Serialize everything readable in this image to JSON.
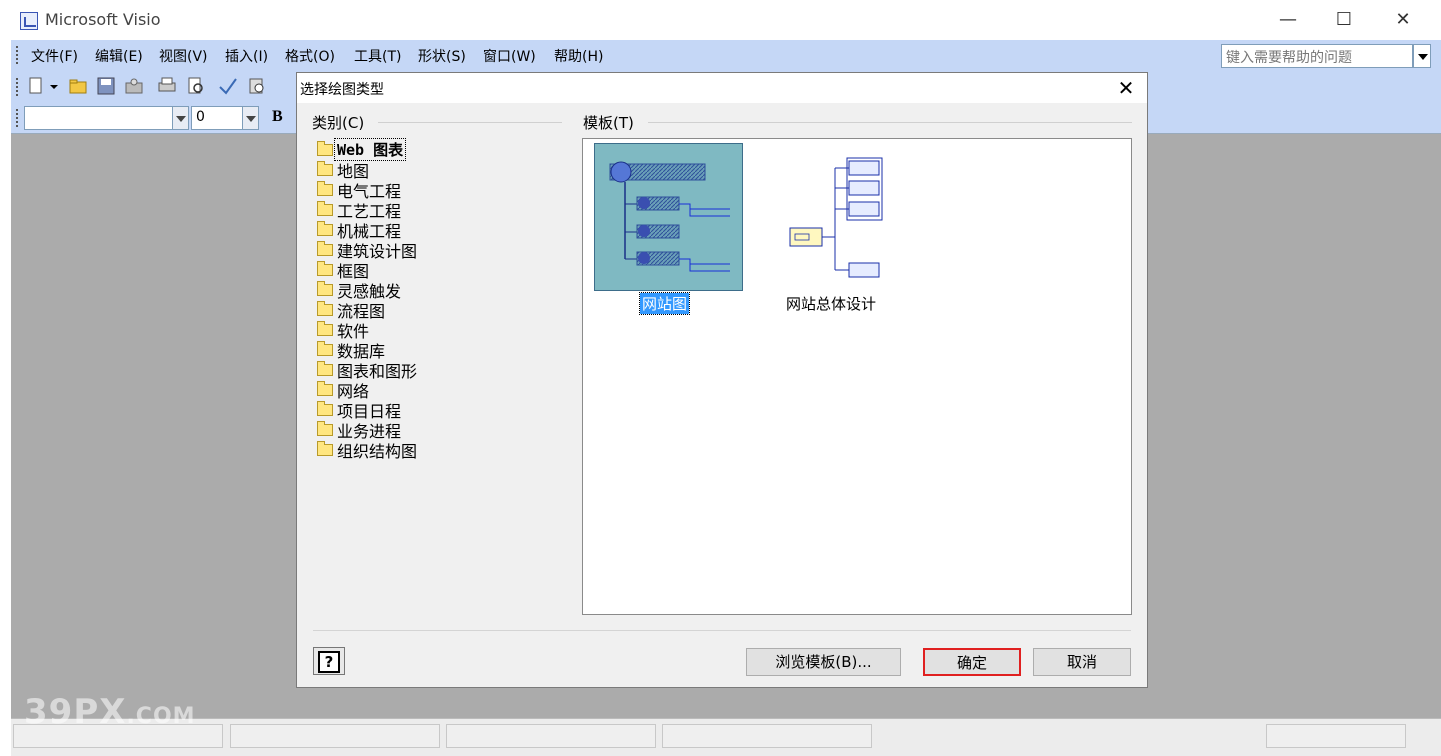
{
  "app": {
    "title": "Microsoft Visio",
    "minimize_glyph": "—",
    "maximize_glyph": "☐",
    "close_glyph": "✕"
  },
  "menu": {
    "items": [
      "文件(F)",
      "编辑(E)",
      "视图(V)",
      "插入(I)",
      "格式(O)",
      "工具(T)",
      "形状(S)",
      "窗口(W)",
      "帮助(H)"
    ],
    "help_placeholder": "键入需要帮助的问题"
  },
  "toolbar": {
    "font_combo_value": "",
    "size_combo_value": "0",
    "bold_label": "B"
  },
  "dialog": {
    "title": "选择绘图类型",
    "close_glyph": "✕",
    "category_label": "类别(C)",
    "template_label": "模板(T)",
    "categories": [
      {
        "label": "Web 图表",
        "selected": true
      },
      {
        "label": "地图"
      },
      {
        "label": "电气工程"
      },
      {
        "label": "工艺工程"
      },
      {
        "label": "机械工程"
      },
      {
        "label": "建筑设计图"
      },
      {
        "label": "框图"
      },
      {
        "label": "灵感触发"
      },
      {
        "label": "流程图"
      },
      {
        "label": "软件"
      },
      {
        "label": "数据库"
      },
      {
        "label": "图表和图形"
      },
      {
        "label": "网络"
      },
      {
        "label": "项目日程"
      },
      {
        "label": "业务进程"
      },
      {
        "label": "组织结构图"
      }
    ],
    "templates": [
      {
        "label": "网站图",
        "selected": true
      },
      {
        "label": "网站总体设计"
      }
    ],
    "help_button_glyph": "?",
    "browse_button": "浏览模板(B)...",
    "ok_button": "确定",
    "cancel_button": "取消"
  },
  "watermark": {
    "brand": "39PX",
    "suffix": ".COM"
  },
  "colors": {
    "menubar": "#c5d7f6",
    "workspace": "#ababab",
    "selection": "#3399ff",
    "ok_highlight": "#e02020"
  }
}
